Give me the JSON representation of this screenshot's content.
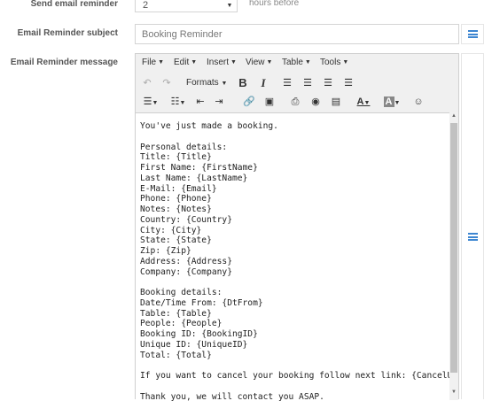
{
  "reminder": {
    "label": "Send email reminder",
    "value": "2",
    "suffix": "hours before"
  },
  "subject": {
    "label": "Email Reminder subject",
    "value": "Booking Reminder"
  },
  "message": {
    "label": "Email Reminder message"
  },
  "menu": [
    "File",
    "Edit",
    "Insert",
    "View",
    "Table",
    "Tools"
  ],
  "toolbar": {
    "formats": "Formats",
    "bold": "B",
    "italic": "I",
    "font_color": "A",
    "bg_color": "A"
  },
  "colors": {
    "accent": "#3d86d1",
    "scroll_thumb": "#c1c1c1"
  },
  "body_lines": [
    "You've just made a booking.",
    "",
    "Personal details:",
    "Title: {Title}",
    "First Name: {FirstName}",
    "Last Name: {LastName}",
    "E-Mail: {Email}",
    "Phone: {Phone}",
    "Notes: {Notes}",
    "Country: {Country}",
    "City: {City}",
    "State: {State}",
    "Zip: {Zip}",
    "Address: {Address}",
    "Company: {Company}",
    "",
    "Booking details:",
    "Date/Time From: {DtFrom}",
    "Table: {Table}",
    "People: {People}",
    "Booking ID: {BookingID}",
    "Unique ID: {UniqueID}",
    "Total: {Total}",
    "",
    "If you want to cancel your booking follow next link: {CancelURL}",
    "",
    "Thank you, we will contact you ASAP."
  ]
}
